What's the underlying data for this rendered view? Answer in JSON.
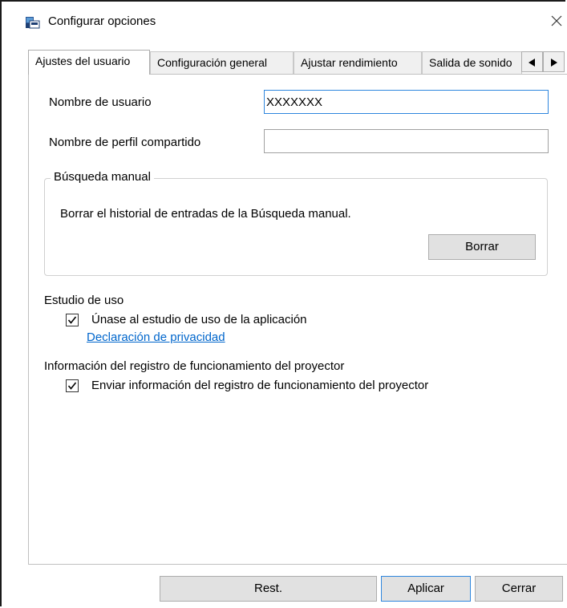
{
  "window": {
    "title": "Configurar opciones",
    "icon": "projector-app-icon",
    "close_icon": "close-icon"
  },
  "tabs": [
    {
      "label": "Ajustes del usuario",
      "active": true
    },
    {
      "label": "Configuración general",
      "active": false
    },
    {
      "label": "Ajustar rendimiento",
      "active": false
    },
    {
      "label": "Salida de sonido",
      "active": false
    }
  ],
  "tab_scroll": {
    "left_icon": "triangle-left-icon",
    "right_icon": "triangle-right-icon"
  },
  "user": {
    "username_label": "Nombre de usuario",
    "username_value": "XXXXXXX",
    "shared_profile_label": "Nombre de perfil compartido",
    "shared_profile_value": ""
  },
  "manual_search": {
    "title": "Búsqueda manual",
    "description": "Borrar el historial de entradas de la Búsqueda manual.",
    "clear_button": "Borrar"
  },
  "usage_study": {
    "title": "Estudio de uso",
    "checkbox_label": "Únase al estudio de uso de la aplicación",
    "checked": true,
    "privacy_link": "Declaración de privacidad"
  },
  "projector_log": {
    "title": "Información del registro de funcionamiento del proyector",
    "checkbox_label": "Enviar información del registro de funcionamiento del proyector",
    "checked": true
  },
  "footer": {
    "reset_button": "Rest.",
    "apply_button": "Aplicar",
    "close_button": "Cerrar"
  }
}
